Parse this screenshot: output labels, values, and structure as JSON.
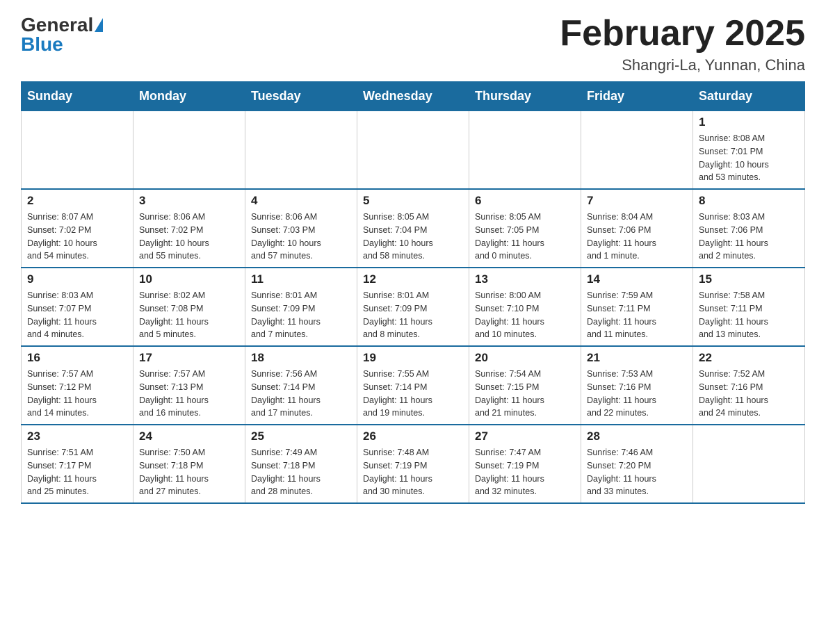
{
  "header": {
    "logo_general": "General",
    "logo_blue": "Blue",
    "title": "February 2025",
    "subtitle": "Shangri-La, Yunnan, China"
  },
  "weekdays": [
    "Sunday",
    "Monday",
    "Tuesday",
    "Wednesday",
    "Thursday",
    "Friday",
    "Saturday"
  ],
  "weeks": [
    [
      {
        "day": "",
        "info": ""
      },
      {
        "day": "",
        "info": ""
      },
      {
        "day": "",
        "info": ""
      },
      {
        "day": "",
        "info": ""
      },
      {
        "day": "",
        "info": ""
      },
      {
        "day": "",
        "info": ""
      },
      {
        "day": "1",
        "info": "Sunrise: 8:08 AM\nSunset: 7:01 PM\nDaylight: 10 hours\nand 53 minutes."
      }
    ],
    [
      {
        "day": "2",
        "info": "Sunrise: 8:07 AM\nSunset: 7:02 PM\nDaylight: 10 hours\nand 54 minutes."
      },
      {
        "day": "3",
        "info": "Sunrise: 8:06 AM\nSunset: 7:02 PM\nDaylight: 10 hours\nand 55 minutes."
      },
      {
        "day": "4",
        "info": "Sunrise: 8:06 AM\nSunset: 7:03 PM\nDaylight: 10 hours\nand 57 minutes."
      },
      {
        "day": "5",
        "info": "Sunrise: 8:05 AM\nSunset: 7:04 PM\nDaylight: 10 hours\nand 58 minutes."
      },
      {
        "day": "6",
        "info": "Sunrise: 8:05 AM\nSunset: 7:05 PM\nDaylight: 11 hours\nand 0 minutes."
      },
      {
        "day": "7",
        "info": "Sunrise: 8:04 AM\nSunset: 7:06 PM\nDaylight: 11 hours\nand 1 minute."
      },
      {
        "day": "8",
        "info": "Sunrise: 8:03 AM\nSunset: 7:06 PM\nDaylight: 11 hours\nand 2 minutes."
      }
    ],
    [
      {
        "day": "9",
        "info": "Sunrise: 8:03 AM\nSunset: 7:07 PM\nDaylight: 11 hours\nand 4 minutes."
      },
      {
        "day": "10",
        "info": "Sunrise: 8:02 AM\nSunset: 7:08 PM\nDaylight: 11 hours\nand 5 minutes."
      },
      {
        "day": "11",
        "info": "Sunrise: 8:01 AM\nSunset: 7:09 PM\nDaylight: 11 hours\nand 7 minutes."
      },
      {
        "day": "12",
        "info": "Sunrise: 8:01 AM\nSunset: 7:09 PM\nDaylight: 11 hours\nand 8 minutes."
      },
      {
        "day": "13",
        "info": "Sunrise: 8:00 AM\nSunset: 7:10 PM\nDaylight: 11 hours\nand 10 minutes."
      },
      {
        "day": "14",
        "info": "Sunrise: 7:59 AM\nSunset: 7:11 PM\nDaylight: 11 hours\nand 11 minutes."
      },
      {
        "day": "15",
        "info": "Sunrise: 7:58 AM\nSunset: 7:11 PM\nDaylight: 11 hours\nand 13 minutes."
      }
    ],
    [
      {
        "day": "16",
        "info": "Sunrise: 7:57 AM\nSunset: 7:12 PM\nDaylight: 11 hours\nand 14 minutes."
      },
      {
        "day": "17",
        "info": "Sunrise: 7:57 AM\nSunset: 7:13 PM\nDaylight: 11 hours\nand 16 minutes."
      },
      {
        "day": "18",
        "info": "Sunrise: 7:56 AM\nSunset: 7:14 PM\nDaylight: 11 hours\nand 17 minutes."
      },
      {
        "day": "19",
        "info": "Sunrise: 7:55 AM\nSunset: 7:14 PM\nDaylight: 11 hours\nand 19 minutes."
      },
      {
        "day": "20",
        "info": "Sunrise: 7:54 AM\nSunset: 7:15 PM\nDaylight: 11 hours\nand 21 minutes."
      },
      {
        "day": "21",
        "info": "Sunrise: 7:53 AM\nSunset: 7:16 PM\nDaylight: 11 hours\nand 22 minutes."
      },
      {
        "day": "22",
        "info": "Sunrise: 7:52 AM\nSunset: 7:16 PM\nDaylight: 11 hours\nand 24 minutes."
      }
    ],
    [
      {
        "day": "23",
        "info": "Sunrise: 7:51 AM\nSunset: 7:17 PM\nDaylight: 11 hours\nand 25 minutes."
      },
      {
        "day": "24",
        "info": "Sunrise: 7:50 AM\nSunset: 7:18 PM\nDaylight: 11 hours\nand 27 minutes."
      },
      {
        "day": "25",
        "info": "Sunrise: 7:49 AM\nSunset: 7:18 PM\nDaylight: 11 hours\nand 28 minutes."
      },
      {
        "day": "26",
        "info": "Sunrise: 7:48 AM\nSunset: 7:19 PM\nDaylight: 11 hours\nand 30 minutes."
      },
      {
        "day": "27",
        "info": "Sunrise: 7:47 AM\nSunset: 7:19 PM\nDaylight: 11 hours\nand 32 minutes."
      },
      {
        "day": "28",
        "info": "Sunrise: 7:46 AM\nSunset: 7:20 PM\nDaylight: 11 hours\nand 33 minutes."
      },
      {
        "day": "",
        "info": ""
      }
    ]
  ]
}
